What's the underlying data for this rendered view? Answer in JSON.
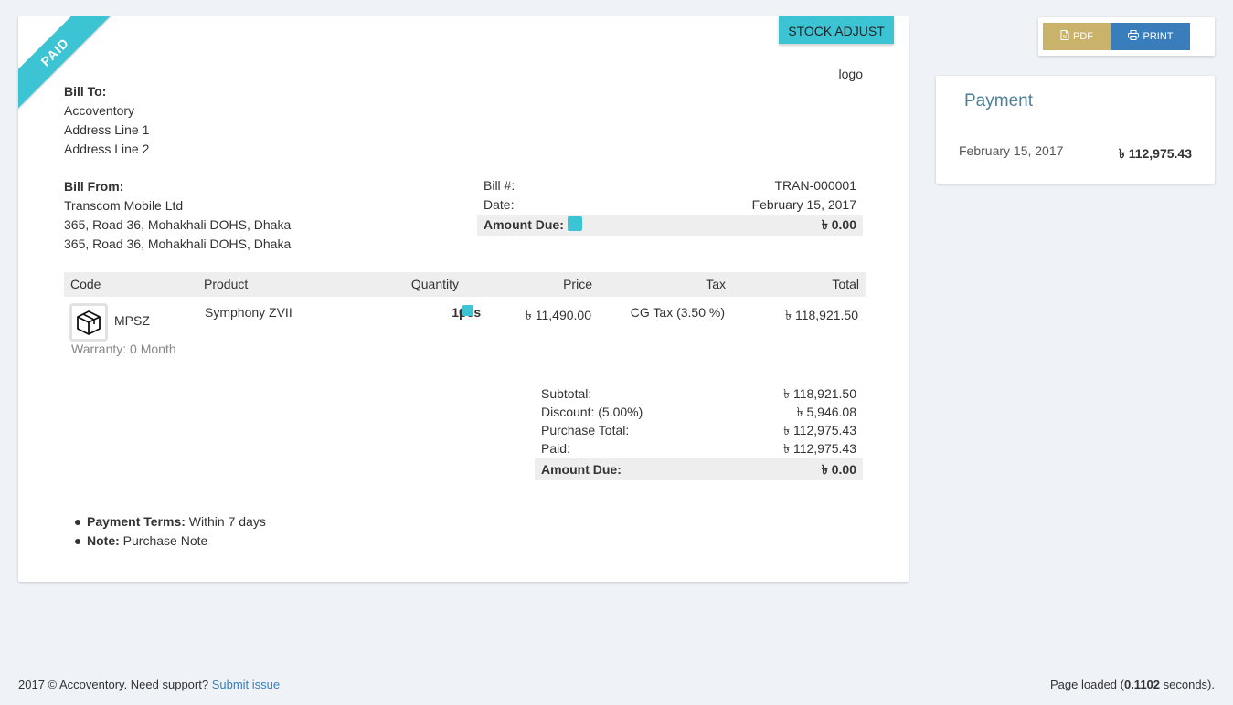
{
  "ribbon": "PAID",
  "badge": "STOCK ADJUST",
  "logo": "logo",
  "bill_to": {
    "label": "Bill To:",
    "lines": [
      "Accoventory",
      "Address Line 1",
      "Address Line 2"
    ]
  },
  "bill_from": {
    "label": "Bill From:",
    "lines": [
      "Transcom Mobile Ltd",
      "365, Road 36, Mohakhali DOHS, Dhaka",
      "365, Road 36, Mohakhali DOHS, Dhaka"
    ]
  },
  "meta": {
    "bill_label": "Bill #:",
    "bill_value": "TRAN-000001",
    "date_label": "Date:",
    "date_value": "February 15, 2017",
    "due_label": "Amount Due:",
    "due_value": "৳ 0.00"
  },
  "items": {
    "headers": [
      "Code",
      "Product",
      "Quantity",
      "Price",
      "Tax",
      "Total"
    ],
    "rows": [
      {
        "code": "MPSZ",
        "product": "Symphony ZVII",
        "qty": "10",
        "unit": "pcs",
        "price": "৳ 11,490.00",
        "tax": "CG Tax (3.50 %)",
        "total": "৳ 118,921.50",
        "warranty": "Warranty: 0 Month"
      }
    ]
  },
  "totals": [
    {
      "label": "Subtotal:",
      "value": "৳ 118,921.50"
    },
    {
      "label": "Discount: (5.00%)",
      "value": "৳ 5,946.08"
    },
    {
      "label": "Purchase Total:",
      "value": "৳ 112,975.43"
    },
    {
      "label": "Paid:",
      "value": "৳ 112,975.43"
    },
    {
      "label": "Amount Due:",
      "value": "৳ 0.00"
    }
  ],
  "notes": {
    "terms_label": "Payment Terms:",
    "terms_value": " Within 7 days",
    "note_label": "Note:",
    "note_value": " Purchase Note"
  },
  "actions": {
    "pdf": "PDF",
    "print": "PRINT"
  },
  "payment": {
    "title": "Payment",
    "date": "February 15, 2017",
    "amount": "৳ 112,975.43"
  },
  "footer": {
    "left_text": "2017 © Accoventory. Need support? ",
    "link": "Submit issue",
    "right_prefix": "Page loaded (",
    "right_value": "0.1102",
    "right_suffix": " seconds)."
  },
  "colors": {
    "accent": "#3cc4d4",
    "pdf": "#c9b26a",
    "print": "#3a7dbd",
    "payment_title": "#4d7f97"
  }
}
